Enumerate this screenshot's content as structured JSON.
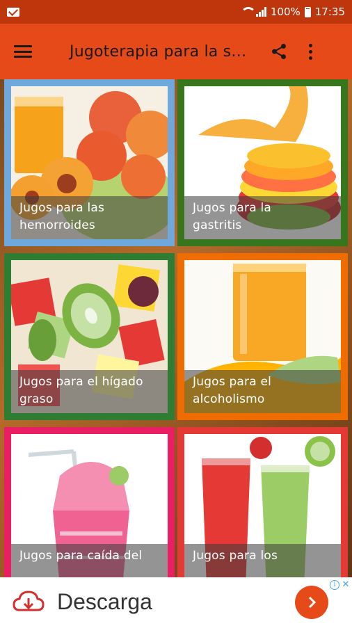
{
  "status_bar": {
    "battery_percent": "100%",
    "time": "17:35",
    "icons": [
      "gmail-icon",
      "wifi-icon",
      "signal-icon",
      "battery-icon"
    ]
  },
  "app_bar": {
    "title": "Jugoterapia para la s…",
    "icons": [
      "menu-icon",
      "share-icon",
      "more-vert-icon"
    ],
    "color": "#e64a19"
  },
  "tiles": [
    {
      "line1": "Jugos para las",
      "line2": "hemorroides",
      "border_color": "#6fa8dc"
    },
    {
      "line1": "Jugos para la",
      "line2": "gastritis",
      "border_color": "#38761d"
    },
    {
      "line1": "Jugos para el hígado",
      "line2": "graso",
      "border_color": "#2e7d32"
    },
    {
      "line1": "Jugos para el",
      "line2": "alcoholismo",
      "border_color": "#ef6c00"
    },
    {
      "line1": "Jugos para caída del",
      "line2": "",
      "border_color": "#e91e63"
    },
    {
      "line1": "Jugos para los",
      "line2": "",
      "border_color": "#e53935"
    }
  ],
  "ad": {
    "text": "Descarga",
    "icons": [
      "cloud-download-icon",
      "chevron-right-icon",
      "ad-info-icon",
      "ad-close-icon"
    ]
  }
}
